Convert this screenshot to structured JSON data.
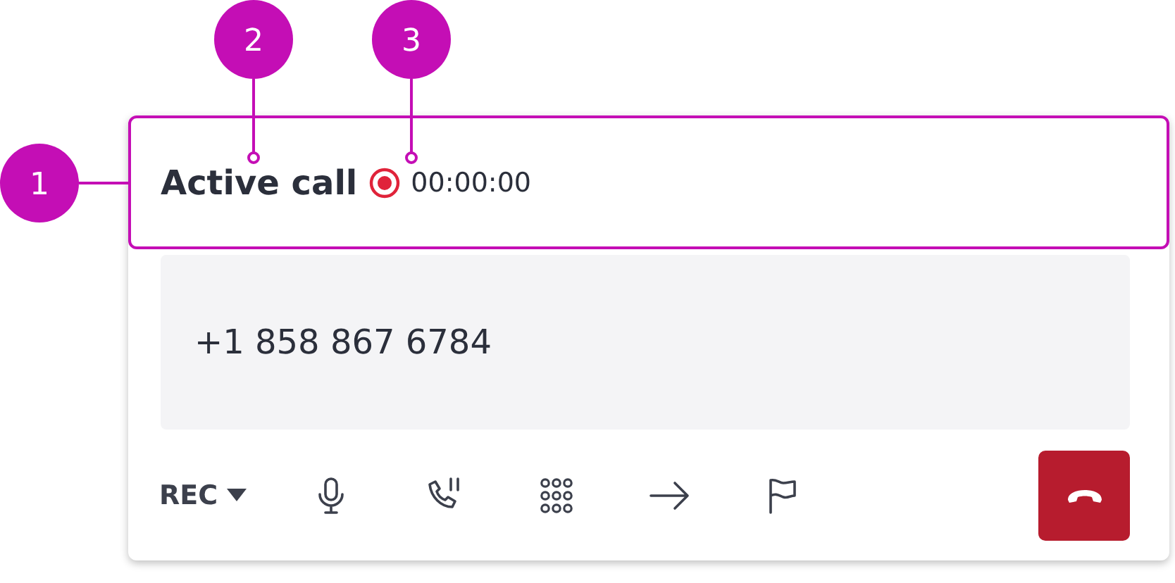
{
  "callouts": [
    {
      "label": "1"
    },
    {
      "label": "2"
    },
    {
      "label": "3"
    }
  ],
  "header": {
    "title": "Active call",
    "recording": true,
    "timer": "00:00:00"
  },
  "phone_number": "+1 858 867 6784",
  "toolbar": {
    "rec_button": "REC",
    "actions": [
      {
        "kind": "mic"
      },
      {
        "kind": "hold"
      },
      {
        "kind": "keypad"
      },
      {
        "kind": "transfer"
      },
      {
        "kind": "flag"
      }
    ]
  }
}
